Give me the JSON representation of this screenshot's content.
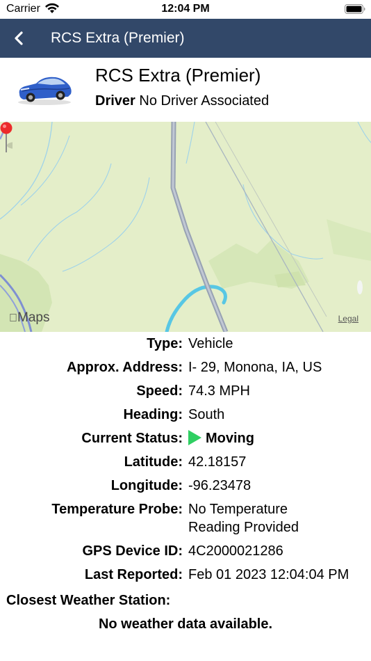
{
  "status_bar": {
    "carrier": "Carrier",
    "time": "12:04 PM"
  },
  "nav": {
    "title": "RCS Extra (Premier)",
    "back_icon": "chevron-left-icon",
    "background": "#324869"
  },
  "vehicle": {
    "name": "RCS Extra (Premier)",
    "driver_label": "Driver",
    "driver_value": "No Driver Associated",
    "icon": "car-icon"
  },
  "map": {
    "logo": "Maps",
    "legal": "Legal",
    "pin_icon": "map-pin-icon"
  },
  "details": [
    {
      "label": "Type:",
      "value": "Vehicle"
    },
    {
      "label": "Approx. Address:",
      "value": "I- 29, Monona, IA, US"
    },
    {
      "label": "Speed:",
      "value": "74.3 MPH"
    },
    {
      "label": "Heading:",
      "value": "South"
    },
    {
      "label": "Current Status:",
      "value": "Moving",
      "icon": "play-icon",
      "icon_color": "#2fcf62"
    },
    {
      "label": "Latitude:",
      "value": "42.18157"
    },
    {
      "label": "Longitude:",
      "value": "-96.23478"
    },
    {
      "label": "Temperature Probe:",
      "value": "No Temperature\nReading Provided"
    },
    {
      "label": "GPS Device ID:",
      "value": "4C2000021286"
    },
    {
      "label": "Last Reported:",
      "value": "Feb 01 2023 12:04:04 PM"
    }
  ],
  "weather": {
    "label": "Closest Weather Station:",
    "message": "No weather data available."
  }
}
